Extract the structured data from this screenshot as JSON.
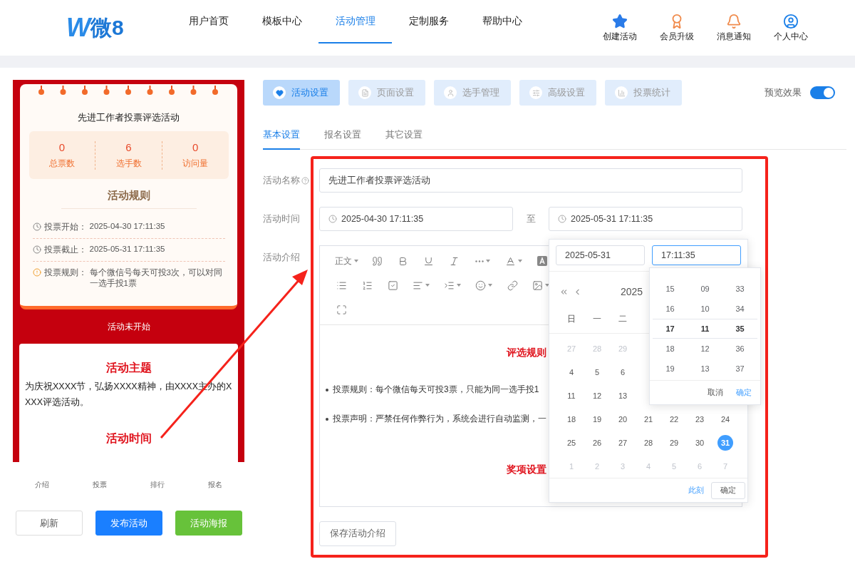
{
  "header": {
    "logo": {
      "mark": "W",
      "text": "微8"
    },
    "nav": [
      {
        "label": "用户首页",
        "selected": false
      },
      {
        "label": "模板中心",
        "selected": false
      },
      {
        "label": "活动管理",
        "selected": true
      },
      {
        "label": "定制服务",
        "selected": false
      },
      {
        "label": "帮助中心",
        "selected": false
      }
    ],
    "actions": [
      {
        "label": "创建活动",
        "kind": "star"
      },
      {
        "label": "会员升级",
        "kind": "badge"
      },
      {
        "label": "消息通知",
        "kind": "bell"
      },
      {
        "label": "个人中心",
        "kind": "user"
      }
    ]
  },
  "preview": {
    "title": "先进工作者投票评选活动",
    "stats": [
      {
        "value": "0",
        "label": "总票数"
      },
      {
        "value": "6",
        "label": "选手数"
      },
      {
        "value": "0",
        "label": "访问量"
      }
    ],
    "rules_title": "活动规则",
    "rules": [
      {
        "kind": "time",
        "label": "投票开始：",
        "value": "2025-04-30 17:11:35"
      },
      {
        "kind": "time",
        "label": "投票截止：",
        "value": "2025-05-31 17:11:35"
      },
      {
        "kind": "info",
        "label": "投票规则：",
        "value": "每个微信号每天可投3次，可以对同一选手投1票"
      }
    ],
    "status": "活动未开始",
    "content": [
      {
        "kind": "heading",
        "text": "活动主题"
      },
      {
        "kind": "paragraph",
        "text": "为庆祝XXXX节，弘扬XXXX精神，由XXXX主办的XXXX评选活动。"
      },
      {
        "kind": "heading",
        "text": "活动时间"
      }
    ],
    "nav": [
      "介绍",
      "投票",
      "排行",
      "报名"
    ]
  },
  "buttons": [
    {
      "label": "刷新",
      "kind": "default"
    },
    {
      "label": "发布活动",
      "kind": "primary"
    },
    {
      "label": "活动海报",
      "kind": "success"
    }
  ],
  "tabs": [
    {
      "label": "活动设置",
      "selected": true,
      "kind": "heart"
    },
    {
      "label": "页面设置",
      "selected": false,
      "kind": "page"
    },
    {
      "label": "选手管理",
      "selected": false,
      "kind": "user"
    },
    {
      "label": "高级设置",
      "selected": false,
      "kind": "tools"
    },
    {
      "label": "投票统计",
      "selected": false,
      "kind": "chart"
    }
  ],
  "preview_toggle": {
    "label": "预览效果",
    "on": true
  },
  "subtabs": [
    {
      "label": "基本设置",
      "selected": true
    },
    {
      "label": "报名设置",
      "selected": false
    },
    {
      "label": "其它设置",
      "selected": false
    }
  ],
  "form": {
    "name": {
      "label": "活动名称",
      "value": "先进工作者投票评选活动"
    },
    "time": {
      "label": "活动时间",
      "start": "2025-04-30 17:11:35",
      "separator": "至",
      "end": "2025-05-31 17:11:35"
    },
    "intro": {
      "label": "活动介绍",
      "toolbar": [
        [
          {
            "kind": "text",
            "text": "正文",
            "dropdown": true
          },
          {
            "kind": "quote",
            "dropdown": false
          },
          {
            "kind": "bold",
            "dropdown": false
          },
          {
            "kind": "underline",
            "dropdown": false
          },
          {
            "kind": "italic",
            "dropdown": false
          },
          {
            "kind": "more",
            "dropdown": true
          },
          {
            "kind": "color",
            "dropdown": true
          },
          {
            "kind": "background",
            "dropdown": false
          }
        ],
        [
          {
            "kind": "bullets",
            "dropdown": false
          },
          {
            "kind": "numbers",
            "dropdown": false
          },
          {
            "kind": "todo",
            "dropdown": false
          },
          {
            "kind": "align",
            "dropdown": true
          },
          {
            "kind": "indent",
            "dropdown": true
          },
          {
            "kind": "emoji",
            "dropdown": true
          },
          {
            "kind": "link",
            "dropdown": false
          },
          {
            "kind": "image",
            "dropdown": true
          }
        ],
        [
          {
            "kind": "fullscreen",
            "dropdown": false
          }
        ]
      ],
      "content": [
        {
          "kind": "heading",
          "text": "评选规则"
        },
        {
          "kind": "bullet",
          "text": "投票规则：每个微信每天可投3票，只能为同一选手投1"
        },
        {
          "kind": "bullet",
          "text": "投票声明：严禁任何作弊行为，系统会进行自动监测，一"
        },
        {
          "kind": "heading",
          "text": "奖项设置"
        }
      ]
    },
    "save": "保存活动介绍"
  },
  "date_picker": {
    "date": "2025-05-31",
    "time": "17:11:35",
    "header": "2025",
    "weekdays": [
      "日",
      "一",
      "二"
    ],
    "weeks": [
      [
        {
          "day": "27",
          "muted": true,
          "selected": false
        },
        {
          "day": "28",
          "muted": true,
          "selected": false
        },
        {
          "day": "29",
          "muted": true,
          "selected": false
        }
      ],
      [
        {
          "day": "4",
          "muted": false,
          "selected": false
        },
        {
          "day": "5",
          "muted": false,
          "selected": false
        },
        {
          "day": "6",
          "muted": false,
          "selected": false
        }
      ],
      [
        {
          "day": "11",
          "muted": false,
          "selected": false
        },
        {
          "day": "12",
          "muted": false,
          "selected": false
        },
        {
          "day": "13",
          "muted": false,
          "selected": false
        }
      ],
      [
        {
          "day": "18",
          "muted": false,
          "selected": false
        },
        {
          "day": "19",
          "muted": false,
          "selected": false
        },
        {
          "day": "20",
          "muted": false,
          "selected": false
        },
        {
          "day": "21",
          "muted": false,
          "selected": false
        },
        {
          "day": "22",
          "muted": false,
          "selected": false
        },
        {
          "day": "23",
          "muted": false,
          "selected": false
        },
        {
          "day": "24",
          "muted": false,
          "selected": false
        }
      ],
      [
        {
          "day": "25",
          "muted": false,
          "selected": false
        },
        {
          "day": "26",
          "muted": false,
          "selected": false
        },
        {
          "day": "27",
          "muted": false,
          "selected": false
        },
        {
          "day": "28",
          "muted": false,
          "selected": false
        },
        {
          "day": "29",
          "muted": false,
          "selected": false
        },
        {
          "day": "30",
          "muted": false,
          "selected": false
        },
        {
          "day": "31",
          "muted": false,
          "selected": true
        }
      ],
      [
        {
          "day": "1",
          "muted": true,
          "selected": false
        },
        {
          "day": "2",
          "muted": true,
          "selected": false
        },
        {
          "day": "3",
          "muted": true,
          "selected": false
        },
        {
          "day": "4",
          "muted": true,
          "selected": false
        },
        {
          "day": "5",
          "muted": true,
          "selected": false
        },
        {
          "day": "6",
          "muted": true,
          "selected": false
        },
        {
          "day": "7",
          "muted": true,
          "selected": false
        }
      ]
    ],
    "now": "此刻",
    "confirm": "确定",
    "time_panel": {
      "columns": [
        [
          {
            "value": "15",
            "selected": false
          },
          {
            "value": "16",
            "selected": false
          },
          {
            "value": "17",
            "selected": true
          },
          {
            "value": "18",
            "selected": false
          },
          {
            "value": "19",
            "selected": false
          }
        ],
        [
          {
            "value": "09",
            "selected": false
          },
          {
            "value": "10",
            "selected": false
          },
          {
            "value": "11",
            "selected": true
          },
          {
            "value": "12",
            "selected": false
          },
          {
            "value": "13",
            "selected": false
          }
        ],
        [
          {
            "value": "33",
            "selected": false
          },
          {
            "value": "34",
            "selected": false
          },
          {
            "value": "35",
            "selected": true
          },
          {
            "value": "36",
            "selected": false
          },
          {
            "value": "37",
            "selected": false
          }
        ]
      ],
      "cancel": "取消",
      "confirm": "确定"
    }
  }
}
